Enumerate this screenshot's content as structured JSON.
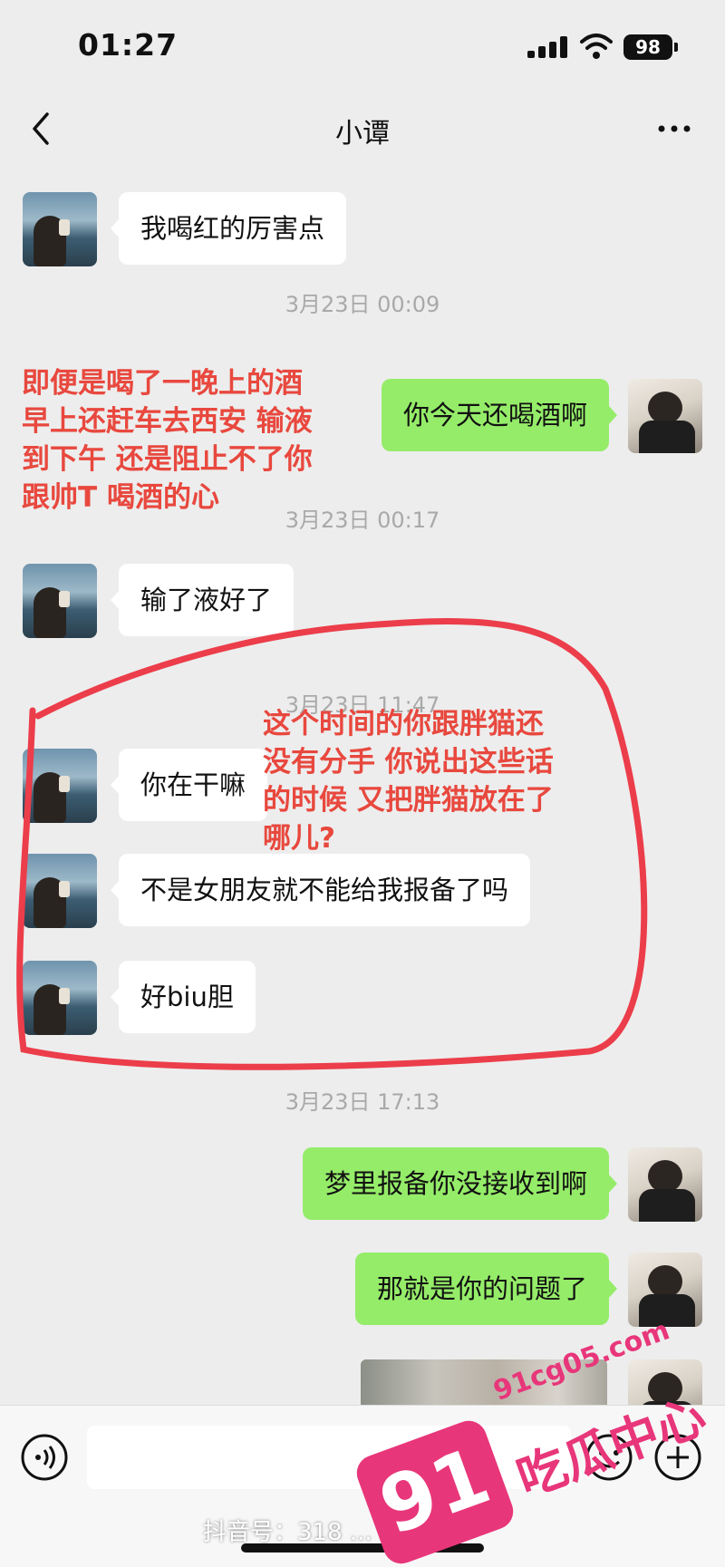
{
  "status_bar": {
    "time": "01:27",
    "battery": "98"
  },
  "header": {
    "title": "小谭"
  },
  "messages": [
    {
      "from": "her",
      "text": "我喝红的厉害点"
    },
    {
      "from": "me",
      "text": "你今天还喝酒啊"
    },
    {
      "from": "her",
      "text": "输了液好了"
    },
    {
      "from": "her",
      "text": "你在干嘛"
    },
    {
      "from": "her",
      "text": "不是女朋友就不能给我报备了吗"
    },
    {
      "from": "her",
      "text": "好biu胆"
    },
    {
      "from": "me",
      "text": "梦里报备你没接收到啊"
    },
    {
      "from": "me",
      "text": "那就是你的问题了"
    }
  ],
  "timestamps": [
    "3月23日 00:09",
    "3月23日 00:17",
    "3月23日 11:47",
    "3月23日 17:13"
  ],
  "annotations": {
    "first": [
      "即便是喝了一晚上的酒",
      "早上还赶车去西安 输液",
      "到下午 还是阻止不了你",
      "跟帅T 喝酒的心"
    ],
    "second": [
      "这个时间的你跟胖猫还",
      "没有分手 你说出这些话",
      "的时候 又把胖猫放在了",
      "哪儿?"
    ]
  },
  "watermarks": {
    "douyin": "抖音号：318 ... 287",
    "site_number": "91",
    "site_domain": "91cg05.com",
    "site_name": "吃瓜中心"
  },
  "colors": {
    "outgoing_bubble": "#95ec69",
    "incoming_bubble": "#ffffff",
    "annotation": "#e8483e",
    "watermark": "#e8367a",
    "background": "#ededed"
  }
}
